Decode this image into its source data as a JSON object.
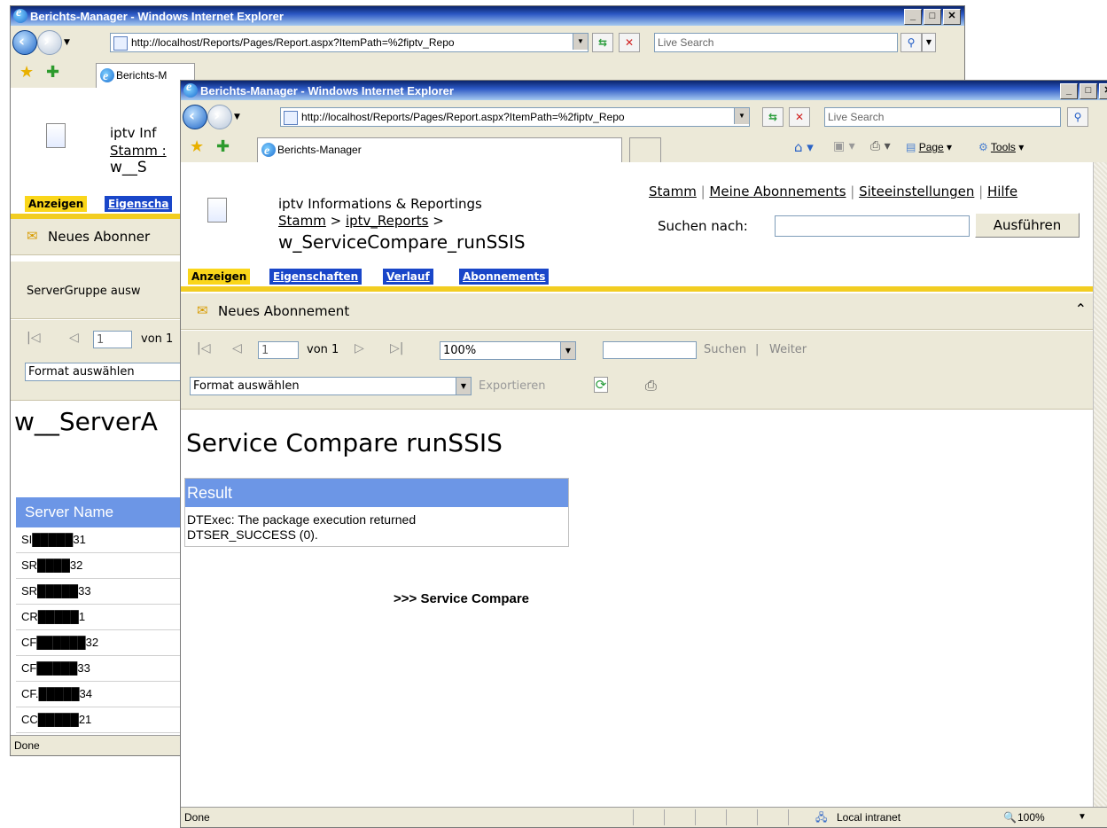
{
  "back_window": {
    "title": "Berichts-Manager - Windows Internet Explorer",
    "address": "http://localhost/Reports/Pages/Report.aspx?ItemPath=%2fiptv_Repo",
    "search_placeholder": "Live Search",
    "tab_label": "Berichts-M",
    "site_title": "iptv  Inf",
    "breadcrumb": "Stamm :",
    "report_title": "w__S",
    "tabs": [
      "Anzeigen",
      "Eigenscha"
    ],
    "new_subscription": "Neues Abonner",
    "param_label": "ServerGruppe ausw",
    "page_input": "1",
    "page_of": "von 1",
    "format_select": "Format auswählen",
    "report_heading": "w__ServerA",
    "table_header": "Server Name",
    "rows": [
      "SI█████31",
      "SR████32",
      "SR█████33",
      "CR█████1",
      "CF██████32",
      "CF█████33",
      "CF.█████34",
      "CC█████21"
    ],
    "status": "Done"
  },
  "front_window": {
    "title": "Berichts-Manager - Windows Internet Explorer",
    "address": "http://localhost/Reports/Pages/Report.aspx?ItemPath=%2fiptv_Repo",
    "search_placeholder": "Live Search",
    "tab_label": "Berichts-Manager",
    "commandbar": {
      "page": "Page",
      "tools": "Tools"
    },
    "site_title": "iptv  Informations & Reportings",
    "breadcrumb": {
      "home": "Stamm",
      "sep1": " > ",
      "folder": "iptv_Reports",
      "sep2": " >"
    },
    "report_title": "w_ServiceCompare_runSSIS",
    "toplinks": {
      "home": "Stamm",
      "subs": "Meine Abonnements",
      "site": "Siteeinstellungen",
      "help": "Hilfe",
      "sep": " | "
    },
    "search_label": "Suchen nach:",
    "search_button": "Ausführen",
    "tabs": [
      "Anzeigen",
      "Eigenschaften",
      "Verlauf",
      "Abonnements"
    ],
    "new_subscription": "Neues Abonnement",
    "toolbar": {
      "page_input": "1",
      "page_of": "von 1",
      "zoom": "100%",
      "find_link": "Suchen",
      "next_link": "Weiter",
      "format_select": "Format auswählen",
      "export_link": "Exportieren"
    },
    "report": {
      "heading": "Service Compare runSSIS",
      "result_header": "Result",
      "result_text": "DTExec: The package execution returned DTSER_SUCCESS (0).",
      "link": ">>> Service Compare"
    },
    "status": {
      "text": "Done",
      "zone": "Local intranet",
      "zoom": "100%"
    }
  },
  "colors": {
    "title_bar": "#0a246a",
    "tab_blue": "#1946c9",
    "tab_yellow": "#fad61a",
    "result_header": "#6c96e6"
  }
}
